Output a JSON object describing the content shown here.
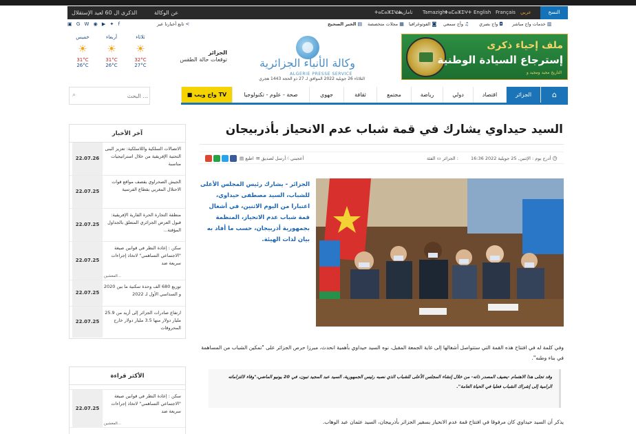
{
  "topbar": {
    "left_1": "الذكرى ال 60 لعيد الإستقلال",
    "left_2": "عن الوكالة",
    "languages": [
      "النسخ",
      "عربي",
      "Français",
      "English",
      "ⵜⴰⵎⴰⵣⵉⵖⵜ",
      "Tamazight",
      "تامازيغت",
      "ⵜⴰⵎⴰⵣⵉⵖⵜ"
    ],
    "active_language": "عربي"
  },
  "linkrow": {
    "follow": "تابع أخبارنا عبر",
    "items": [
      "الخبر الصحيح",
      "مجلات متخصصة",
      "الفوتوغرافيا",
      "وأج سمعي",
      "واج بصري",
      "خدمات واج مباشر"
    ]
  },
  "header": {
    "ad_line1": "ملف إحياء ذكرى",
    "ad_line2": "إسترجاع السيادة الوطنية",
    "ad_line3": "التاريخ مجيد ومجيد و",
    "logo_ar": "وكالة الأنباء الجزائرية",
    "logo_fr": "ALGERIE PRESSE SERVICE",
    "date_line": "الثلاثاء 26 جويلية 2022 الموافق لـ 27 ذو الحجة 1443 هجري"
  },
  "weather": {
    "city": "الجزائر",
    "subtitle": "توقعات حالة الطقس",
    "days": [
      {
        "name": "خميس",
        "hi": "31°C",
        "lo": "26°C"
      },
      {
        "name": "أربعاء",
        "hi": "31°C",
        "lo": "26°C"
      },
      {
        "name": "ثلاثاء",
        "hi": "32°C",
        "lo": "27°C"
      }
    ]
  },
  "nav": {
    "search_placeholder": "البحث ...",
    "items": [
      "الجزائر",
      "اقتصاد",
      "دولي",
      "رياضة",
      "مجتمع",
      "ثقافة",
      "جهوي",
      "صحة - علوم - تكنولوجيا",
      "واج ويب TV"
    ]
  },
  "article": {
    "title": "السيد حيداوي يشارك في قمة شباب عدم الانحياز بأذربيجان",
    "meta_date": "أدرج يوم : الإثنين, 25 جويلية 2022 16:36",
    "meta_category_label": "الفئة :",
    "meta_category": "الجزائر",
    "meta_print": "اطبع",
    "meta_send": "أرسل لصديق",
    "meta_likes": "أعجبني",
    "lead": "الجزائر - يشارك رئيس المجلس الأعلى للشباب، السيد مصطفى حيداوي، اعتبارا من اليوم الاثنين، في أشغال قمة شباب عدم الانحياز، المنظمة بجمهورية أذربيجان، حسب ما أفاد به بيان لذات الهيئة.",
    "para1": "وفي كلمة له في افتتاح هذه القمة التي ستتواصل أشغالها إلى غاية الجمعة المقبل، نوه السيد حيداوي بأهمية انحدث، مبرزا حرص الجزائر على \"تمكين الشباب من المساهمة في بناء وطنه\".",
    "quote": "وقد تجلى هذا الاهتمام -يضيف المصدر ذاته- من خلال إنشاء المجلس الأعلى للشباب الذي نصبه رئيس الجمهورية، السيد عبد المجيد تبون، في 20 يونيو الماضي،\"وفاء لالتزاماته الرامية إلى إشراك الشباب فعليا في الحياة العامة\".",
    "para2": "يذكر أن السيد حيداوي كان مرفوقا في افتتاح قمة عدم الانحياز بسفير الجزائر بأذربيجان، السيد عثمان عبد الوهاب."
  },
  "sidebar_latest": {
    "title": "آخر الأخبار",
    "items": [
      {
        "date": "22.07.26",
        "text": "الاتصالات السلكية واللاسلكية: تعزيز البنى التحتية الإفريقية من خلال استراتيجيات مناسبة"
      },
      {
        "date": "22.07.25",
        "text": "الجيش الصحراوي يقصف مواقع قوات الاحتلال المغربي بقطاع الفرسية"
      },
      {
        "date": "22.07.25",
        "text": "منطقة التجارة الحرة القارية الإفريقية: قبول العرض الجزائري المتعلق بالجداول المؤقتة..."
      },
      {
        "date": "22.07.25",
        "text": "سكن : إعادة النظر في قوانين صيغة \"الاجتماعي التساهمي\" لاتخاذ إجراءات سريعة ضد",
        "more": "المغشين..."
      },
      {
        "date": "22.07.25",
        "text": "توزيع 680 الف وحدة سكنية ما بين 2020 و السداسي الأول لـ 2022"
      },
      {
        "date": "22.07.25",
        "text": "ارتفاع صادرات الجزائر إلى أزيد من 25.9 مليار دولار منها 3.5 مليار دولار خارج المحروقات"
      }
    ]
  },
  "sidebar_most_read": {
    "title": "الأكثر قراءة",
    "items": [
      {
        "date": "22.07.25",
        "text": "سكن : إعادة النظر في قوانين صيغة \"الاجتماعي التساهمي\" لاتخاذ إجراءات سريعة ضد",
        "more": "المغشين..."
      }
    ]
  },
  "colors": {
    "brand_blue": "#1c74b8",
    "tv_yellow": "#f4d300",
    "lead_blue": "#1c64b0"
  }
}
